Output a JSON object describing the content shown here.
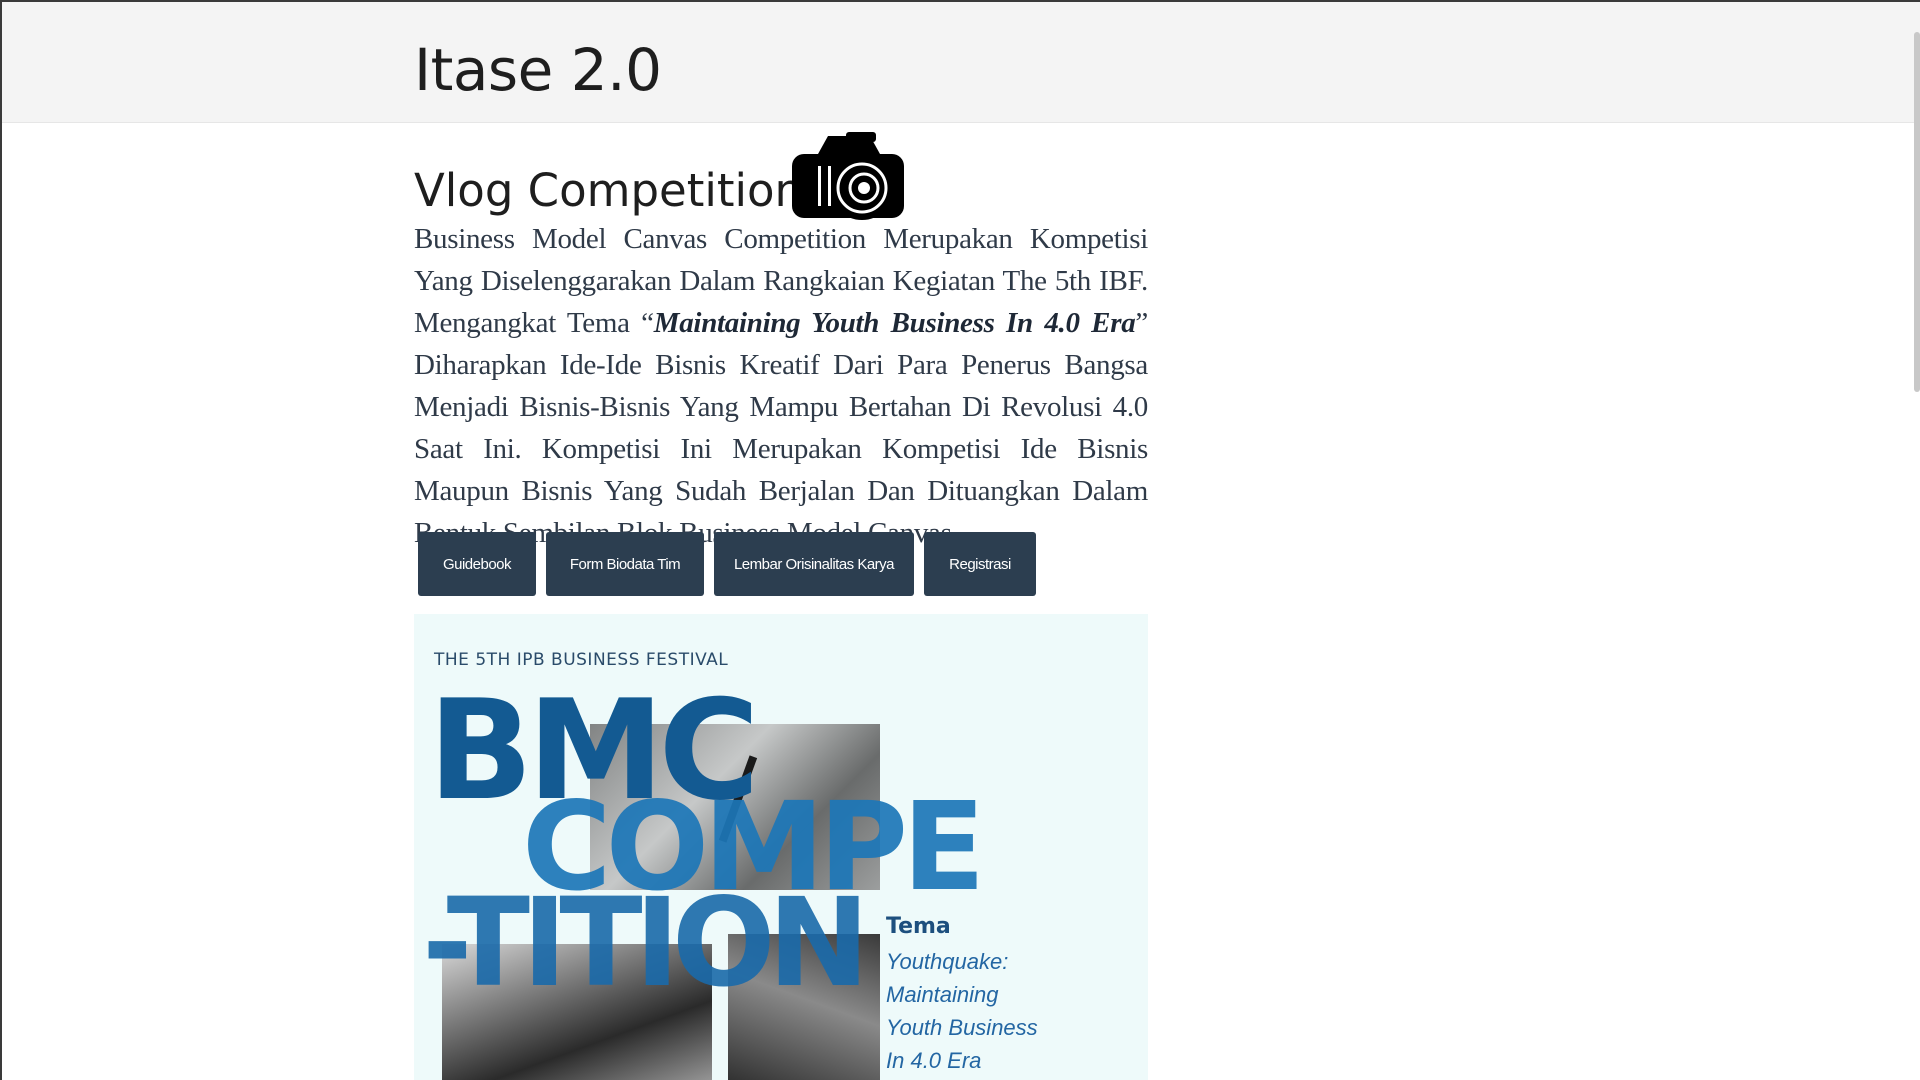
{
  "navbar": {
    "brand": "Itase 2.0"
  },
  "section": {
    "heading": "Vlog Competition",
    "icon": "camera-icon",
    "description_before": "Business Model Canvas Competition Merupakan Kompetisi Yang Diselenggarakan Dalam Rangkaian Kegiatan The 5th IBF. Mengangkat Tema “",
    "description_emphasis": "Maintaining Youth Business In 4.0 Era",
    "description_after": "” Diharapkan Ide-Ide Bisnis Kreatif Dari Para Penerus Bangsa Menjadi Bisnis-Bisnis Yang Mampu Bertahan Di Revolusi 4.0 Saat Ini. Kompetisi Ini Merupakan Kompetisi Ide Bisnis Maupun Bisnis Yang Sudah Berjalan Dan Dituangkan Dalam Bentuk Sembilan Blok Business Model Canvas"
  },
  "buttons": [
    {
      "label": "Guidebook"
    },
    {
      "label": "Form Biodata Tim"
    },
    {
      "label": "Lembar Orisinalitas Karya"
    },
    {
      "label": "Registrasi"
    }
  ],
  "poster": {
    "kicker": "THE 5TH IPB BUSINESS FESTIVAL",
    "word_1": "BMC",
    "word_2": "COMPE",
    "word_3": "-TITION",
    "tema_title": "Tema",
    "tema_lines": [
      "Youthquake:",
      "Maintaining",
      "Youth Business",
      "In 4.0 Era"
    ]
  },
  "colors": {
    "navbar_bg": "#f4f4f4",
    "button_bg": "#2c3e50",
    "button_text": "#ffffff",
    "poster_bg": "#eefafa",
    "poster_blue": "#135a92"
  }
}
